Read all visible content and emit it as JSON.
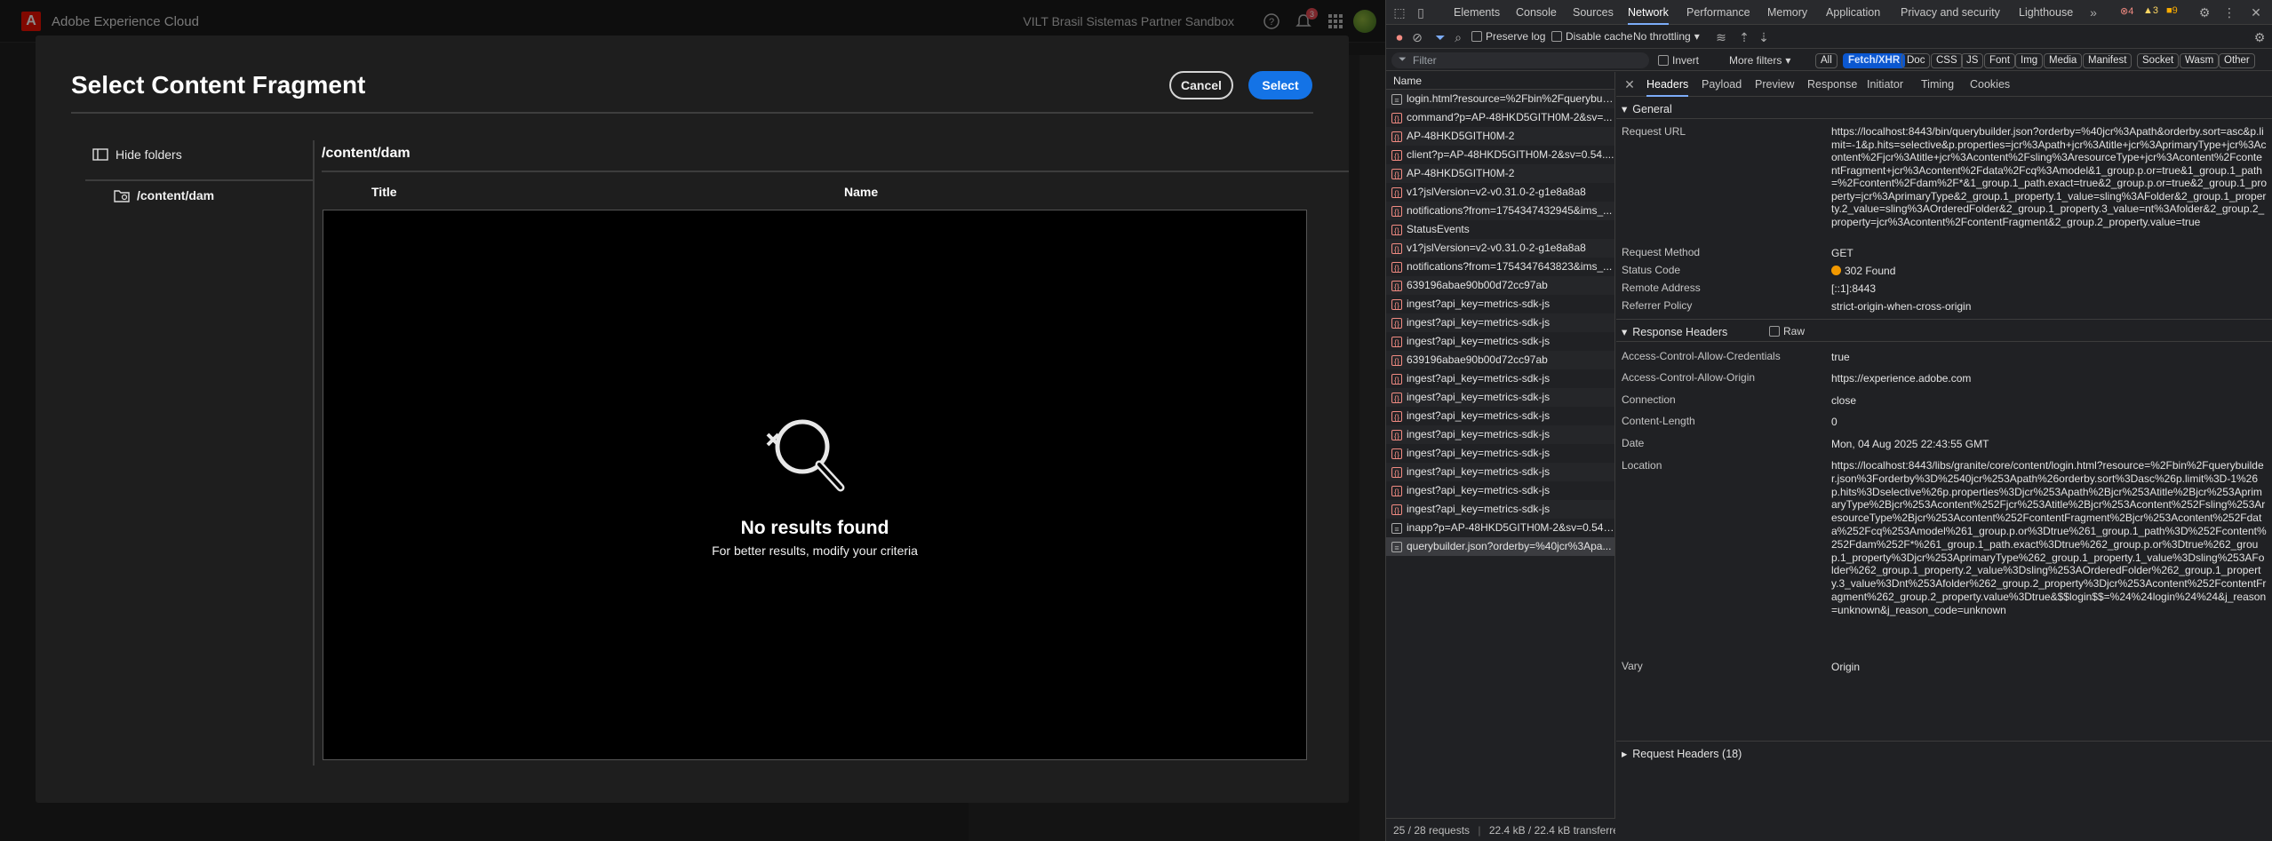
{
  "app": {
    "brand": "Adobe Experience Cloud",
    "org": "VILT Brasil Sistemas Partner Sandbox",
    "notification_count": "3"
  },
  "dialog": {
    "title": "Select Content Fragment",
    "cancel_label": "Cancel",
    "select_label": "Select",
    "hide_folders_label": "Hide folders",
    "folder_item": "/content/dam",
    "path_title": "/content/dam",
    "columns": {
      "title": "Title",
      "name": "Name"
    },
    "empty_title": "No results found",
    "empty_subtitle": "For better results, modify your criteria"
  },
  "devtools": {
    "tabs": [
      "Elements",
      "Console",
      "Sources",
      "Network",
      "Performance",
      "Memory",
      "Application",
      "Privacy and security",
      "Lighthouse"
    ],
    "active_tab": "Network",
    "errors": "4",
    "warnings": "3",
    "info": "9",
    "toolbar": {
      "preserve_log": "Preserve log",
      "disable_cache": "Disable cache",
      "throttling": "No throttling"
    },
    "filter": {
      "placeholder": "Filter",
      "invert": "Invert",
      "more_filters": "More filters",
      "types": [
        "All",
        "Fetch/XHR",
        "Doc",
        "CSS",
        "JS",
        "Font",
        "Img",
        "Media",
        "Manifest",
        "Socket",
        "Wasm",
        "Other"
      ],
      "active_type": "Fetch/XHR"
    },
    "requests_header": "Name",
    "requests": [
      {
        "name": "login.html?resource=%2Fbin%2Fquerybuil...",
        "error": false,
        "icon": "doc"
      },
      {
        "name": "command?p=AP-48HKD5GITH0M-2&sv=...",
        "error": false,
        "icon": "xhr"
      },
      {
        "name": "AP-48HKD5GITH0M-2",
        "error": false,
        "icon": "xhr"
      },
      {
        "name": "client?p=AP-48HKD5GITH0M-2&sv=0.54....",
        "error": false,
        "icon": "xhr"
      },
      {
        "name": "AP-48HKD5GITH0M-2",
        "error": false,
        "icon": "xhr"
      },
      {
        "name": "v1?jslVersion=v2-v0.31.0-2-g1e8a8a8",
        "error": false,
        "icon": "xhr"
      },
      {
        "name": "notifications?from=1754347432945&ims_...",
        "error": false,
        "icon": "xhr"
      },
      {
        "name": "StatusEvents",
        "error": false,
        "icon": "xhr"
      },
      {
        "name": "v1?jslVersion=v2-v0.31.0-2-g1e8a8a8",
        "error": false,
        "icon": "xhr"
      },
      {
        "name": "notifications?from=1754347643823&ims_...",
        "error": false,
        "icon": "xhr"
      },
      {
        "name": "639196abae90b00d72cc97ab",
        "error": false,
        "icon": "xhr"
      },
      {
        "name": "ingest?api_key=metrics-sdk-js",
        "error": false,
        "icon": "xhr"
      },
      {
        "name": "ingest?api_key=metrics-sdk-js",
        "error": false,
        "icon": "xhr"
      },
      {
        "name": "ingest?api_key=metrics-sdk-js",
        "error": false,
        "icon": "xhr"
      },
      {
        "name": "639196abae90b00d72cc97ab",
        "error": false,
        "icon": "xhr"
      },
      {
        "name": "ingest?api_key=metrics-sdk-js",
        "error": false,
        "icon": "xhr"
      },
      {
        "name": "ingest?api_key=metrics-sdk-js",
        "error": false,
        "icon": "xhr"
      },
      {
        "name": "ingest?api_key=metrics-sdk-js",
        "error": false,
        "icon": "xhr"
      },
      {
        "name": "ingest?api_key=metrics-sdk-js",
        "error": false,
        "icon": "xhr"
      },
      {
        "name": "ingest?api_key=metrics-sdk-js",
        "error": false,
        "icon": "xhr"
      },
      {
        "name": "ingest?api_key=metrics-sdk-js",
        "error": false,
        "icon": "xhr"
      },
      {
        "name": "ingest?api_key=metrics-sdk-js",
        "error": false,
        "icon": "xhr"
      },
      {
        "name": "ingest?api_key=metrics-sdk-js",
        "error": false,
        "icon": "xhr"
      },
      {
        "name": "inapp?p=AP-48HKD5GITH0M-2&sv=0.54....",
        "error": false,
        "icon": "doc"
      },
      {
        "name": "querybuilder.json?orderby=%40jcr%3Apa...",
        "error": false,
        "icon": "doc",
        "selected": true
      }
    ],
    "status_summary": "25 / 28 requests",
    "transfer_summary": "22.4 kB / 22.4 kB transferred",
    "detail_tabs": [
      "Headers",
      "Payload",
      "Preview",
      "Response",
      "Initiator",
      "Timing",
      "Cookies"
    ],
    "active_detail_tab": "Headers",
    "general_label": "General",
    "general": {
      "request_url_label": "Request URL",
      "request_url": "https://localhost:8443/bin/querybuilder.json?orderby=%40jcr%3Apath&orderby.sort=asc&p.limit=-1&p.hits=selective&p.properties=jcr%3Apath+jcr%3Atitle+jcr%3AprimaryType+jcr%3Acontent%2Fjcr%3Atitle+jcr%3Acontent%2Fsling%3AresourceType+jcr%3Acontent%2FcontentFragment+jcr%3Acontent%2Fdata%2Fcq%3Amodel&1_group.p.or=true&1_group.1_path=%2Fcontent%2Fdam%2F*&1_group.1_path.exact=true&2_group.p.or=true&2_group.1_property=jcr%3AprimaryType&2_group.1_property.1_value=sling%3AFolder&2_group.1_property.2_value=sling%3AOrderedFolder&2_group.1_property.3_value=nt%3Afolder&2_group.2_property=jcr%3Acontent%2FcontentFragment&2_group.2_property.value=true",
      "method_label": "Request Method",
      "method": "GET",
      "status_label": "Status Code",
      "status": "302 Found",
      "remote_label": "Remote Address",
      "remote": "[::1]:8443",
      "referrer_label": "Referrer Policy",
      "referrer": "strict-origin-when-cross-origin"
    },
    "response_headers_label": "Response Headers",
    "raw_label": "Raw",
    "response_headers": [
      {
        "k": "Access-Control-Allow-Credentials",
        "v": "true"
      },
      {
        "k": "Access-Control-Allow-Origin",
        "v": "https://experience.adobe.com"
      },
      {
        "k": "Connection",
        "v": "close"
      },
      {
        "k": "Content-Length",
        "v": "0"
      },
      {
        "k": "Date",
        "v": "Mon, 04 Aug 2025 22:43:55 GMT"
      },
      {
        "k": "Location",
        "v": "https://localhost:8443/libs/granite/core/content/login.html?resource=%2Fbin%2Fquerybuilder.json%3Forderby%3D%2540jcr%253Apath%26orderby.sort%3Dasc%26p.limit%3D-1%26p.hits%3Dselective%26p.properties%3Djcr%253Apath%2Bjcr%253Atitle%2Bjcr%253AprimaryType%2Bjcr%253Acontent%252Fjcr%253Atitle%2Bjcr%253Acontent%252Fsling%253AresourceType%2Bjcr%253Acontent%252FcontentFragment%2Bjcr%253Acontent%252Fdata%252Fcq%253Amodel%261_group.p.or%3Dtrue%261_group.1_path%3D%252Fcontent%252Fdam%252F*%261_group.1_path.exact%3Dtrue%262_group.p.or%3Dtrue%262_group.1_property%3Djcr%253AprimaryType%262_group.1_property.1_value%3Dsling%253AFolder%262_group.1_property.2_value%3Dsling%253AOrderedFolder%262_group.1_property.3_value%3Dnt%253Afolder%262_group.2_property%3Djcr%253Acontent%252FcontentFragment%262_group.2_property.value%3Dtrue&$$login$$=%24%24login%24%24&j_reason=unknown&j_reason_code=unknown"
      },
      {
        "k": "Vary",
        "v": "Origin"
      }
    ],
    "request_headers_label": "Request Headers (18)"
  }
}
